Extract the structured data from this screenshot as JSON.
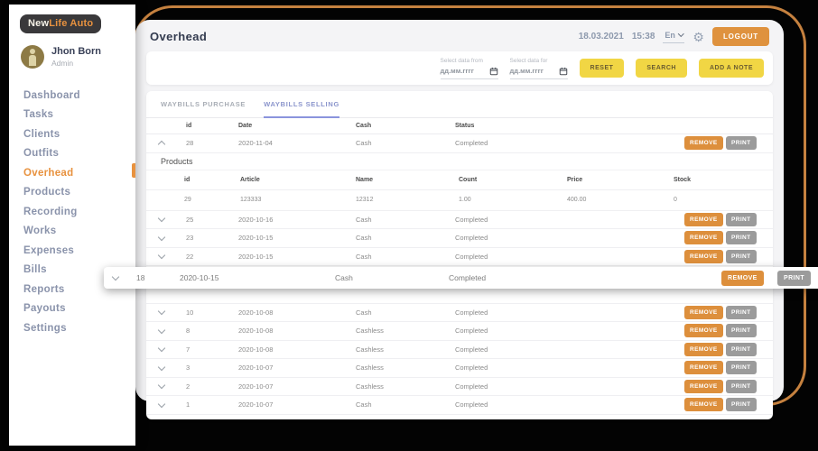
{
  "brand": {
    "name_primary": "New",
    "name_secondary": "Life Auto"
  },
  "user": {
    "name": "Jhon Born",
    "role": "Admin"
  },
  "sidebar": {
    "items": [
      {
        "label": "Dashboard",
        "active": false
      },
      {
        "label": "Tasks",
        "active": false
      },
      {
        "label": "Clients",
        "active": false
      },
      {
        "label": "Outfits",
        "active": false
      },
      {
        "label": "Overhead",
        "active": true
      },
      {
        "label": "Products",
        "active": false
      },
      {
        "label": "Recording",
        "active": false
      },
      {
        "label": "Works",
        "active": false
      },
      {
        "label": "Expenses",
        "active": false
      },
      {
        "label": "Bills",
        "active": false
      },
      {
        "label": "Reports",
        "active": false
      },
      {
        "label": "Payouts",
        "active": false
      },
      {
        "label": "Settings",
        "active": false
      }
    ]
  },
  "header": {
    "title": "Overhead",
    "date": "18.03.2021",
    "time": "15:38",
    "language": "En",
    "logout_label": "LOGOUT"
  },
  "filters": {
    "from_label": "Select data from",
    "for_label": "Select data for",
    "date_placeholder": "дд.мм.гггг",
    "reset_label": "RESET",
    "search_label": "SEARCH",
    "add_note_label": "ADD A NOTE"
  },
  "tabs": [
    {
      "label": "WAYBILLS PURCHASE",
      "active": false
    },
    {
      "label": "WAYBILLS SELLING",
      "active": true
    }
  ],
  "waybills": {
    "columns": {
      "id": "id",
      "date": "Date",
      "cash": "Cash",
      "status": "Status"
    },
    "remove_label": "REMOVE",
    "print_label": "PRINT",
    "expanded": {
      "id": "28",
      "date": "2020-11-04",
      "cash": "Cash",
      "status": "Completed"
    },
    "products": {
      "title": "Products",
      "columns": [
        "id",
        "Article",
        "Name",
        "Count",
        "Price",
        "Stock"
      ],
      "rows": [
        [
          "29",
          "123333",
          "12312",
          "1.00",
          "400.00",
          "0"
        ]
      ]
    },
    "rows": [
      {
        "id": "25",
        "date": "2020-10-16",
        "cash": "Cash",
        "status": "Completed",
        "gap_after": false
      },
      {
        "id": "23",
        "date": "2020-10-15",
        "cash": "Cash",
        "status": "Completed",
        "gap_after": false
      },
      {
        "id": "22",
        "date": "2020-10-15",
        "cash": "Cash",
        "status": "Completed",
        "gap_after": false
      },
      {
        "id": "18",
        "date": "2020-10-15",
        "cash": "Cash",
        "status": "Completed",
        "gap_after": true
      },
      {
        "id": "10",
        "date": "2020-10-08",
        "cash": "Cash",
        "status": "Completed",
        "gap_after": false
      },
      {
        "id": "8",
        "date": "2020-10-08",
        "cash": "Cashless",
        "status": "Completed",
        "gap_after": false
      },
      {
        "id": "7",
        "date": "2020-10-08",
        "cash": "Cashless",
        "status": "Completed",
        "gap_after": false
      },
      {
        "id": "3",
        "date": "2020-10-07",
        "cash": "Cashless",
        "status": "Completed",
        "gap_after": false
      },
      {
        "id": "2",
        "date": "2020-10-07",
        "cash": "Cashless",
        "status": "Completed",
        "gap_after": false
      },
      {
        "id": "1",
        "date": "2020-10-07",
        "cash": "Cash",
        "status": "Completed",
        "gap_after": false
      }
    ],
    "dragged": {
      "id": "18",
      "date": "2020-10-15",
      "cash": "Cash",
      "status": "Completed"
    }
  },
  "colors": {
    "accent_orange": "#e8923f",
    "frame_orange": "#c5813f",
    "button_yellow": "#f1d644",
    "remove_orange": "#dd8f3c",
    "print_gray": "#9b9b9b",
    "tab_active_underline": "#8a94dd"
  }
}
